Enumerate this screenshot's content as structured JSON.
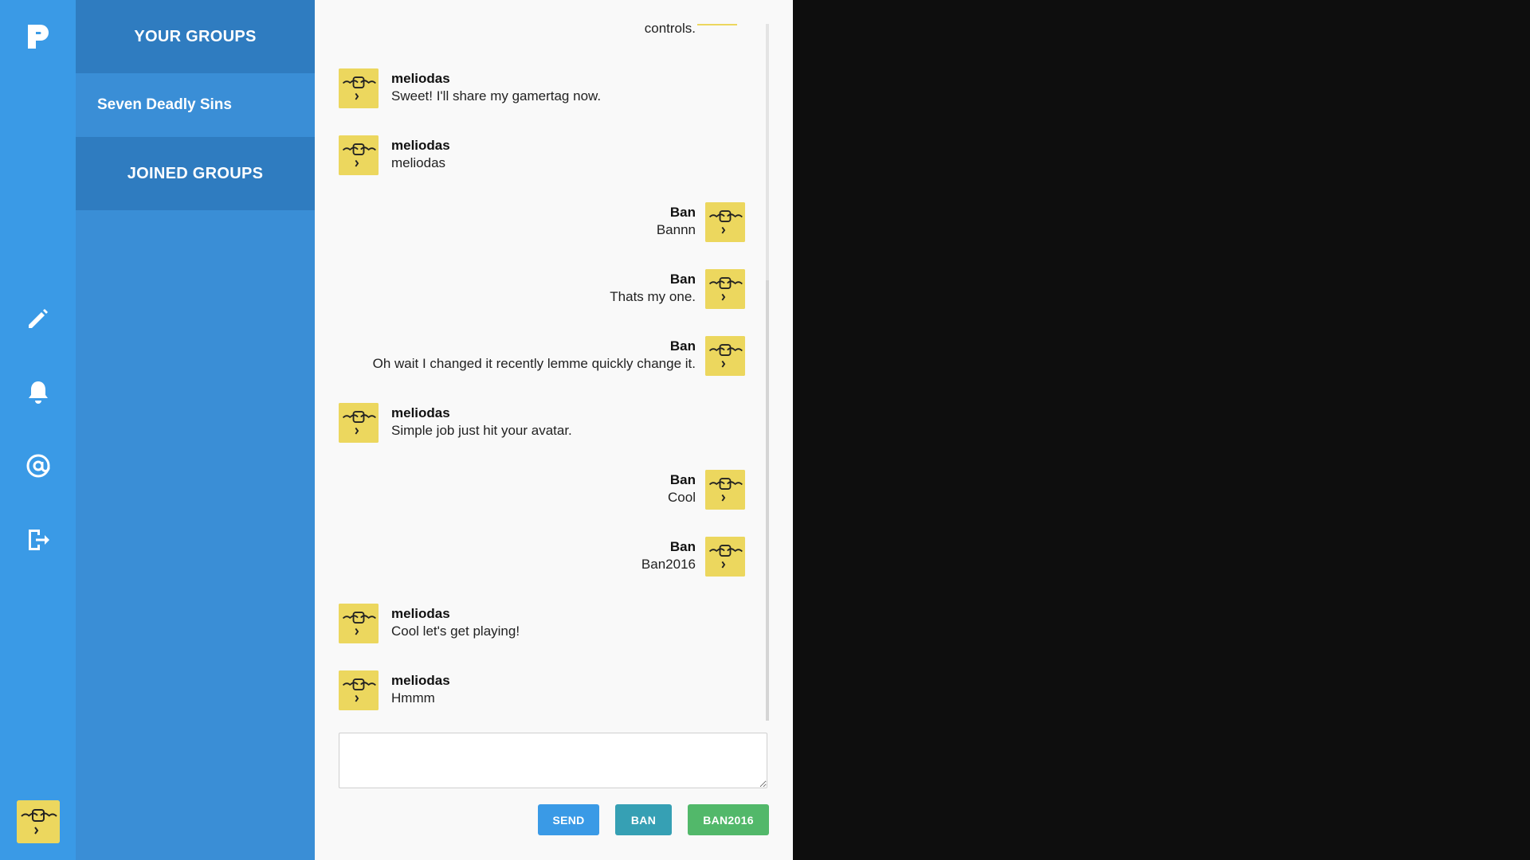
{
  "app": {
    "logo_letter": "P",
    "accent_color": "#3a9ae6",
    "avatar_color": "#ecd75e"
  },
  "rail": {
    "icons": [
      "pencil-icon",
      "bell-icon",
      "at-icon",
      "logout-icon"
    ]
  },
  "groups": {
    "your_groups_label": "YOUR GROUPS",
    "items": [
      {
        "label": "Seven Deadly Sins"
      }
    ],
    "joined_groups_label": "JOINED GROUPS"
  },
  "chat": {
    "partial_text": "controls.",
    "messages": [
      {
        "side": "left",
        "author": "meliodas",
        "text": "Sweet! I'll share my gamertag now."
      },
      {
        "side": "left",
        "author": "meliodas",
        "text": "meliodas"
      },
      {
        "side": "right",
        "author": "Ban",
        "text": "Bannn"
      },
      {
        "side": "right",
        "author": "Ban",
        "text": "Thats my one."
      },
      {
        "side": "right",
        "author": "Ban",
        "text": "Oh wait I changed it recently lemme quickly change it."
      },
      {
        "side": "left",
        "author": "meliodas",
        "text": "Simple job just hit your avatar."
      },
      {
        "side": "right",
        "author": "Ban",
        "text": "Cool"
      },
      {
        "side": "right",
        "author": "Ban",
        "text": "Ban2016"
      },
      {
        "side": "left",
        "author": "meliodas",
        "text": "Cool let's get playing!"
      },
      {
        "side": "left",
        "author": "meliodas",
        "text": "Hmmm"
      }
    ],
    "compose_value": "",
    "buttons": {
      "send": "SEND",
      "ban": "BAN",
      "ban2016": "BAN2016"
    }
  }
}
